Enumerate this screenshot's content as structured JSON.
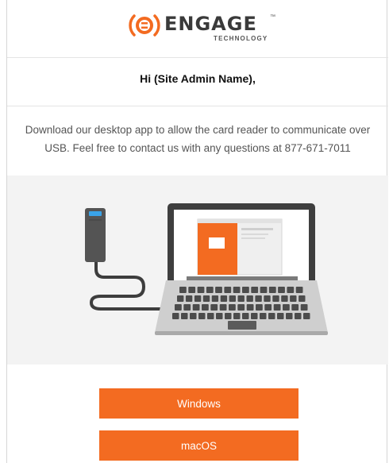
{
  "brand": {
    "name": "ENGAGE",
    "tagline": "TECHNOLOGY",
    "trademark": "™",
    "accent_color": "#f36b21"
  },
  "greeting": "Hi (Site Admin Name),",
  "body_text": "Download our desktop app to allow the card reader to communicate over USB. Feel free to contact us with any questions at 877-671-7011",
  "buttons": {
    "windows": "Windows",
    "macos": "macOS"
  }
}
